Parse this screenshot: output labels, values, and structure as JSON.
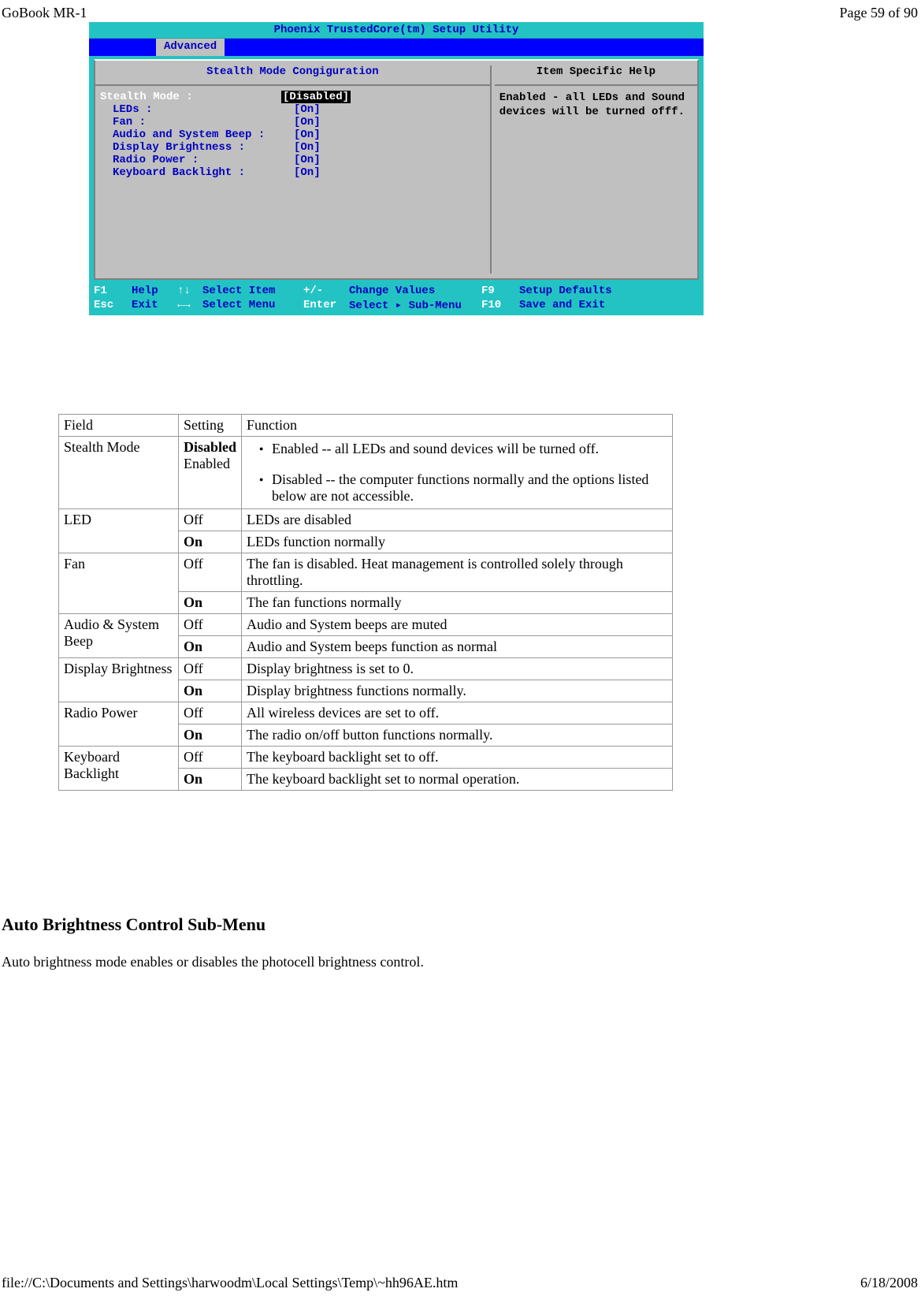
{
  "header": {
    "left": "GoBook MR-1",
    "right": "Page 59 of 90"
  },
  "footer": {
    "left": "file://C:\\Documents and Settings\\harwoodm\\Local Settings\\Temp\\~hh96AE.htm",
    "right": "6/18/2008"
  },
  "bios": {
    "title": "Phoenix TrustedCore(tm) Setup Utility",
    "tab": "Advanced",
    "left_title": "Stealth Mode Congiguration",
    "right_title": "Item Specific Help",
    "help_text": "Enabled - all LEDs and Sound devices will be turned offf.",
    "items": [
      {
        "label": "Stealth Mode :",
        "value": "[Disabled]",
        "selected": true
      },
      {
        "label": "LEDs :",
        "value": "[On]"
      },
      {
        "label": "Fan :",
        "value": "[On]"
      },
      {
        "label": "Audio and System Beep :",
        "value": "[On]"
      },
      {
        "label": "Display Brightness :",
        "value": "[On]"
      },
      {
        "label": "Radio Power :",
        "value": "[On]"
      },
      {
        "label": "Keyboard Backlight :",
        "value": "[On]"
      }
    ],
    "footer": {
      "f1": "F1",
      "help": "Help",
      "ud": "↑↓",
      "selitem": "Select Item",
      "pm": "+/-",
      "chg": "Change Values",
      "f9": "F9",
      "setup": "Setup Defaults",
      "esc": "Esc",
      "exit": "Exit",
      "lr": "←→",
      "selmenu": "Select Menu",
      "enter": "Enter",
      "selsub": "Select ▸ Sub-Menu",
      "f10": "F10",
      "save": "Save and Exit"
    }
  },
  "table": {
    "head": {
      "field": "Field",
      "setting": "Setting",
      "func": "Function"
    },
    "rows": {
      "stealth": {
        "field": "Stealth Mode",
        "setting_bold": "Disabled",
        "setting2": "Enabled",
        "func1": "Enabled -- all LEDs and sound devices will be turned off.",
        "func2": "Disabled -- the computer functions normally and the options listed below are not accessible."
      },
      "led": {
        "field": "LED",
        "off": "Off",
        "off_func": "LEDs are disabled",
        "on": "On",
        "on_func": "LEDs function normally"
      },
      "fan": {
        "field": " Fan",
        "off": "Off",
        "off_func": "The fan is disabled. Heat management is controlled solely through throttling.",
        "on": "On",
        "on_func": "The fan functions normally"
      },
      "audio": {
        "field": "Audio & System Beep",
        "off": "Off",
        "off_func": "Audio and System beeps are muted",
        "on": "On",
        "on_func": "Audio and System beeps function as normal"
      },
      "display": {
        "field": "Display Brightness",
        "off": "Off",
        "off_func": "Display brightness is set to 0.",
        "on": "On",
        "on_func": "Display brightness functions normally."
      },
      "radio": {
        "field": "Radio Power",
        "off": "Off",
        "off_func": "All wireless devices are set to off.",
        "on": "On",
        "on_func": "The radio on/off button functions normally."
      },
      "kb": {
        "field": "Keyboard Backlight",
        "off": "Off",
        "off_func": "The keyboard backlight set to off.",
        "on": "On",
        "on_func": "The keyboard backlight set to normal operation."
      }
    }
  },
  "section": {
    "heading": "Auto Brightness Control Sub-Menu",
    "para": "Auto brightness mode enables or disables the photocell brightness control."
  }
}
